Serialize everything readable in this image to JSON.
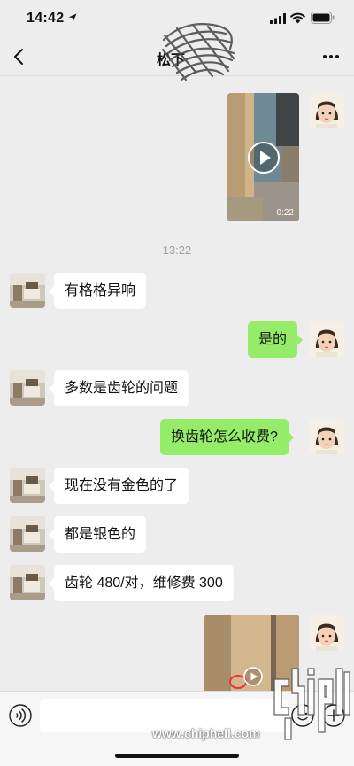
{
  "status_bar": {
    "time": "14:42",
    "icons": [
      "location-arrow-icon",
      "signal-icon",
      "wifi-icon",
      "battery-icon"
    ]
  },
  "nav": {
    "title": "松下",
    "back_icon": "chevron-left-icon",
    "more_icon": "more-dots-icon"
  },
  "timestamp": "13:22",
  "messages": [
    {
      "dir": "out",
      "type": "video",
      "duration": "0:22"
    },
    {
      "dir": "in",
      "text": "有格格异响"
    },
    {
      "dir": "out",
      "text": "是的"
    },
    {
      "dir": "in",
      "text": "多数是齿轮的问题"
    },
    {
      "dir": "out",
      "text": "换齿轮怎么收费?"
    },
    {
      "dir": "in",
      "text": "现在没有金色的了"
    },
    {
      "dir": "in",
      "text": "都是银色的"
    },
    {
      "dir": "in",
      "text": "齿轮 480/对，维修费 300"
    },
    {
      "dir": "out",
      "type": "video"
    }
  ],
  "input_bar": {
    "icons": [
      "voice-icon",
      "emoji-icon",
      "plus-icon"
    ],
    "value": ""
  },
  "watermark": {
    "text": "www.chiphell.com",
    "logo": "chiphell-logo"
  },
  "colors": {
    "background": "#ededed",
    "outgoing_bubble": "#95ec69",
    "incoming_bubble": "#ffffff",
    "timestamp": "#a0a0a0"
  }
}
